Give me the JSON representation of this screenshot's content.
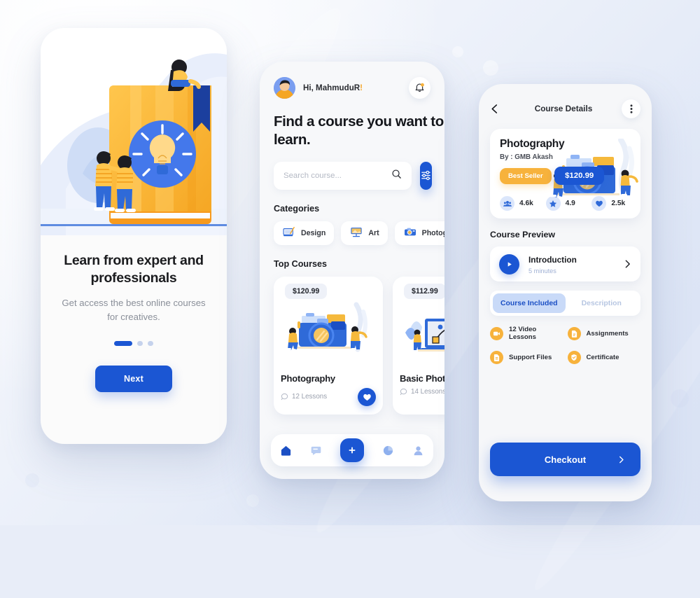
{
  "theme": {
    "brand_blue": "#1b56d3",
    "accent_yellow": "#f7b23c",
    "bg": "#e8edf8",
    "card": "#ffffff",
    "muted_text": "#8a8f99"
  },
  "onboarding": {
    "illustration_name": "book-lightbulb-illustration",
    "title": "Learn from expert and professionals",
    "subtitle": "Get access the best online courses for creatives.",
    "pagination": {
      "total": 3,
      "active_index": 0
    },
    "next_label": "Next"
  },
  "home": {
    "greeting": "Hi, MahmuduR",
    "greeting_mark": "!",
    "avatar_name": "user-avatar",
    "bell_icon": "bell-icon",
    "heading": "Find a course you want to learn.",
    "search": {
      "placeholder": "Search course...",
      "value": "",
      "icon": "search-icon"
    },
    "filter_icon": "sliders-icon",
    "categories_title": "Categories",
    "categories": [
      {
        "label": "Design",
        "icon": "design-tablet-icon"
      },
      {
        "label": "Art",
        "icon": "art-easel-icon"
      },
      {
        "label": "Photography",
        "icon": "camera-icon"
      }
    ],
    "top_courses_title": "Top Courses",
    "courses": [
      {
        "price": "$120.99",
        "name": "Photography",
        "lessons": "12 Lessons",
        "art": "camera-illustration",
        "favorited": true
      },
      {
        "price": "$112.99",
        "name": "Basic Photoshop",
        "lessons": "14 Lessons",
        "art": "laptop-pen-illustration",
        "favorited": false
      }
    ],
    "tabs": [
      {
        "name": "home",
        "icon": "home-icon",
        "active": true
      },
      {
        "name": "messages",
        "icon": "chat-icon",
        "active": false
      },
      {
        "name": "add",
        "icon": "plus-icon",
        "active": false
      },
      {
        "name": "stats",
        "icon": "pie-chart-icon",
        "active": false
      },
      {
        "name": "profile",
        "icon": "person-icon",
        "active": false
      }
    ]
  },
  "details": {
    "back_icon": "chevron-left-icon",
    "title": "Course Details",
    "more_icon": "more-vertical-icon",
    "course": {
      "name": "Photography",
      "author": "By : GMB Akash",
      "badge": "Best Seller",
      "price": "$120.99",
      "art": "camera-illustration"
    },
    "stats": [
      {
        "icon": "people-icon",
        "value": "4.6k"
      },
      {
        "icon": "star-icon",
        "value": "4.9"
      },
      {
        "icon": "heart-icon",
        "value": "2.5k"
      }
    ],
    "preview_title": "Course Preview",
    "preview": {
      "play_icon": "play-icon",
      "name": "Introduction",
      "duration": "5 minutes",
      "chevron_icon": "chevron-right-icon"
    },
    "segments": [
      {
        "label": "Course Included",
        "active": true
      },
      {
        "label": "Description",
        "active": false
      }
    ],
    "features": [
      {
        "label": "12 Video Lessons",
        "icon": "video-icon"
      },
      {
        "label": "Assignments",
        "icon": "file-icon"
      },
      {
        "label": "Support Files",
        "icon": "document-icon"
      },
      {
        "label": "Certificate",
        "icon": "certificate-icon"
      }
    ],
    "checkout_label": "Checkout",
    "checkout_icon": "chevron-right-icon"
  }
}
